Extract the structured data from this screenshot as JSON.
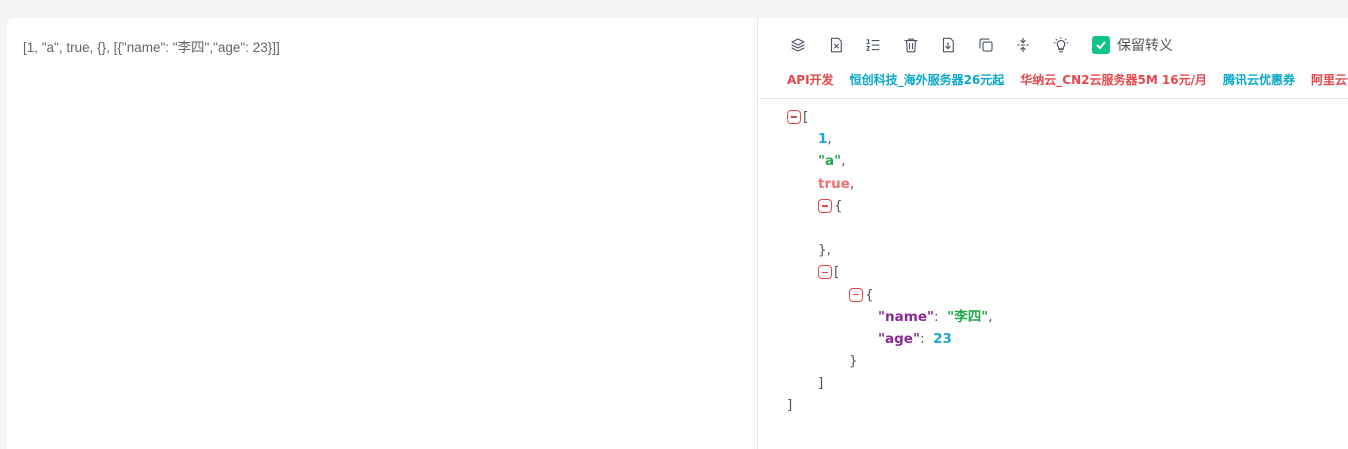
{
  "input": {
    "raw_text": "[1, \"a\", true, {}, [{\"name\": \"李四\",\"age\": 23}]]"
  },
  "toolbar": {
    "icons": [
      "layers-icon",
      "clear-file-icon",
      "sort-list-icon",
      "trash-icon",
      "download-icon",
      "copy-icon",
      "compress-icon",
      "lightbulb-icon"
    ],
    "keep_escape_label": "保留转义",
    "keep_escape_checked": true,
    "accent_color": "#10c48a"
  },
  "ads": [
    {
      "label": "API开发",
      "color": "red"
    },
    {
      "label": "恒创科技_海外服务器26元起",
      "color": "cyan"
    },
    {
      "label": "华纳云_CN2云服务器5M 16元/月",
      "color": "red"
    },
    {
      "label": "腾讯云优惠券",
      "color": "cyan"
    },
    {
      "label": "阿里云优",
      "color": "red"
    }
  ],
  "json_view": {
    "v1": "1",
    "v2": "\"a\"",
    "v3": "true",
    "key_name": "\"name\"",
    "val_name": "\"李四\"",
    "key_age": "\"age\"",
    "val_age": "23"
  }
}
